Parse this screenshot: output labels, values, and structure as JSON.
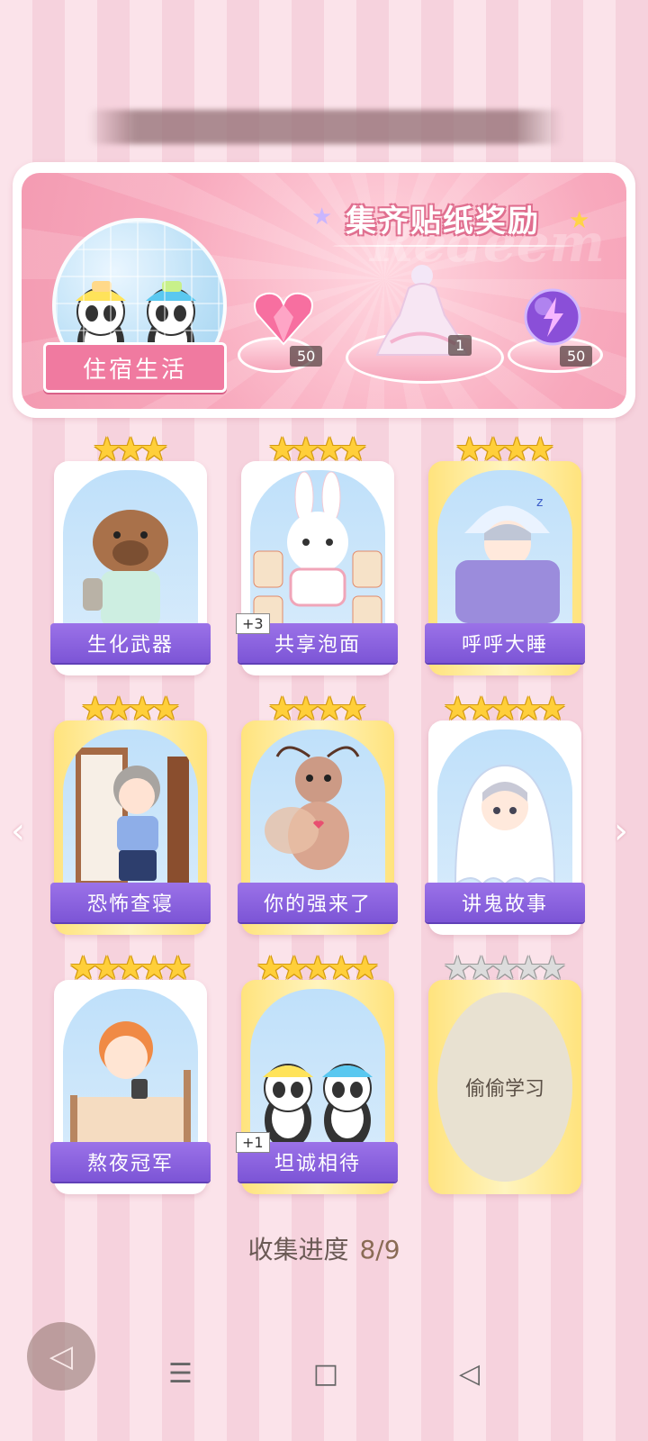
{
  "banner": {
    "title": "集齐贴纸奖励",
    "watermark": "Redeem",
    "theme_tag": "住宿生活",
    "rewards": [
      {
        "icon": "heart-gem-icon",
        "count": "50"
      },
      {
        "icon": "dress-costume-icon",
        "count": "1"
      },
      {
        "icon": "energy-orb-icon",
        "count": "50"
      }
    ]
  },
  "cards": [
    {
      "label": "生化武器",
      "stars": 3,
      "gold_frame": false,
      "badge": null,
      "art": "capybara-sock-icon",
      "locked": false
    },
    {
      "label": "共享泡面",
      "stars": 4,
      "gold_frame": false,
      "badge": "+3",
      "art": "bunny-noodles-icon",
      "locked": false
    },
    {
      "label": "呼呼大睡",
      "stars": 4,
      "gold_frame": true,
      "badge": null,
      "art": "sleeping-boy-icon",
      "locked": false
    },
    {
      "label": "恐怖查寝",
      "stars": 4,
      "gold_frame": true,
      "badge": null,
      "art": "dorm-auntie-icon",
      "locked": false
    },
    {
      "label": "你的强来了",
      "stars": 4,
      "gold_frame": true,
      "badge": null,
      "art": "cockroach-icon",
      "locked": false
    },
    {
      "label": "讲鬼故事",
      "stars": 5,
      "gold_frame": false,
      "badge": null,
      "art": "ghost-boy-icon",
      "locked": false
    },
    {
      "label": "熬夜冠军",
      "stars": 5,
      "gold_frame": false,
      "badge": null,
      "art": "phone-in-bed-icon",
      "locked": false
    },
    {
      "label": "坦诚相待",
      "stars": 5,
      "gold_frame": true,
      "badge": "+1",
      "art": "bathing-pandas-icon",
      "locked": false
    },
    {
      "label": "偷偷学习",
      "stars": 5,
      "gold_frame": true,
      "badge": null,
      "art": "locked-placeholder",
      "locked": true
    }
  ],
  "progress": {
    "label": "收集进度",
    "value": "8/9"
  },
  "nav": {
    "prev": "‹",
    "next": "›"
  },
  "system_nav": {
    "menu": "☰",
    "home": "□",
    "back": "◁"
  },
  "colors": {
    "label_purple": "#8a62de",
    "banner_pink": "#f6a6bb",
    "star_gold": "#ffcf3a"
  }
}
